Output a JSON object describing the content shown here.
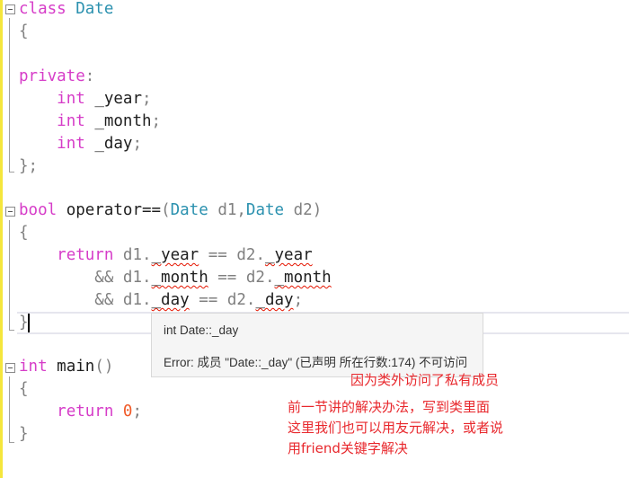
{
  "editor": {
    "class_block": {
      "kw_class": "class",
      "class_name": "Date",
      "open_brace": "{",
      "kw_private": "private",
      "colon": ":",
      "members": [
        {
          "type": "int",
          "name": "_year",
          "semi": ";"
        },
        {
          "type": "int",
          "name": "_month",
          "semi": ";"
        },
        {
          "type": "int",
          "name": "_day",
          "semi": ";"
        }
      ],
      "close_brace": "};"
    },
    "operator_block": {
      "ret_type": "bool",
      "func_name": "operator==",
      "open_paren": "(",
      "param1_type": "Date",
      "param1_name": "d1,",
      "param2_type": "Date",
      "param2_name": "d2",
      "close_paren": ")",
      "open_brace": "{",
      "kw_return": "return",
      "line1": {
        "lhs_obj": "d1.",
        "lhs_mem": "_year",
        "op": " == ",
        "rhs_obj": "d2.",
        "rhs_mem": "_year",
        "tail": ""
      },
      "line2": {
        "prefix": "&& ",
        "lhs_obj": "d1.",
        "lhs_mem": "_month",
        "op": " == ",
        "rhs_obj": "d2.",
        "rhs_mem": "_month",
        "tail": ""
      },
      "line3": {
        "prefix": "&& ",
        "lhs_obj": "d1.",
        "lhs_mem": "_day",
        "op": " == ",
        "rhs_obj": "d2.",
        "rhs_mem": "_day",
        "tail": ";"
      },
      "close_brace": "}"
    },
    "main_block": {
      "ret_type": "int",
      "func_name": "main",
      "parens": "()",
      "open_brace": "{",
      "kw_return": "return",
      "value": "0",
      "semi": ";",
      "close_brace": "}"
    }
  },
  "tooltip": {
    "signature": "int Date::_day",
    "error": "Error: 成员 \"Date::_day\" (已声明 所在行数:174) 不可访问"
  },
  "annotations": {
    "reason": "因为类外访问了私有成员",
    "solution_lines": [
      "前一节讲的解决办法，写到类里面",
      "这里我们也可以用友元解决，或者说",
      "用friend关键字解决"
    ]
  }
}
